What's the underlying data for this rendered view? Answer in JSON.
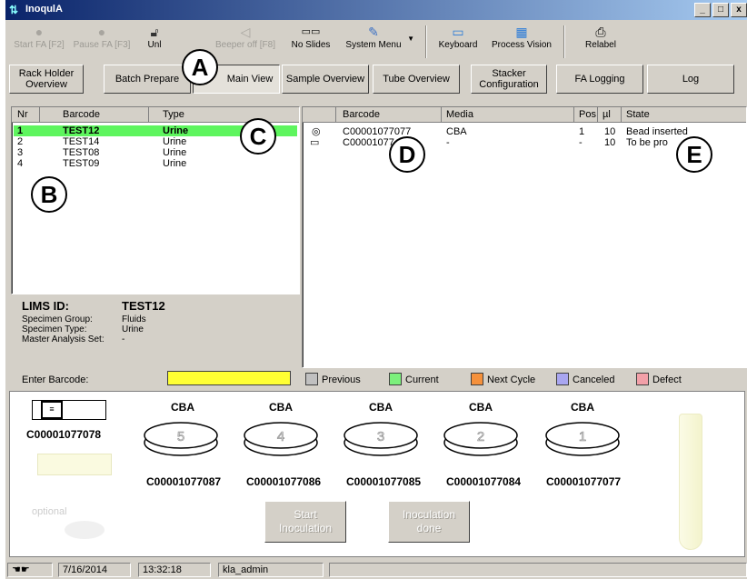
{
  "window": {
    "title": "InoqulA",
    "min": "_",
    "max": "□",
    "close": "x"
  },
  "toolbar": {
    "start": "Start FA [F2]",
    "pause": "Pause FA [F3]",
    "unlock": "Unl",
    "beeper": "Beeper off [F8]",
    "no_slides": "No Slides",
    "system_menu": "System Menu",
    "keyboard": "Keyboard",
    "process_vision": "Process Vision",
    "relabel": "Relabel"
  },
  "tabs": {
    "rack_1": "Rack Holder",
    "rack_2": "Overview",
    "batch": "Batch Prepare",
    "main": "Main View",
    "sample": "Sample Overview",
    "tube": "Tube Overview",
    "stacker_1": "Stacker",
    "stacker_2": "Configuration",
    "fa_logging": "FA Logging",
    "log": "Log"
  },
  "left_table": {
    "headers": {
      "nr": "Nr",
      "barcode": "Barcode",
      "type": "Type"
    },
    "rows": [
      {
        "nr": "1",
        "barcode": "TEST12",
        "type": "Urine"
      },
      {
        "nr": "2",
        "barcode": "TEST14",
        "type": "Urine"
      },
      {
        "nr": "3",
        "barcode": "TEST08",
        "type": "Urine"
      },
      {
        "nr": "4",
        "barcode": "TEST09",
        "type": "Urine"
      }
    ]
  },
  "right_table": {
    "headers": {
      "barcode": "Barcode",
      "media": "Media",
      "pos": "Pos",
      "ul": "µl",
      "state": "State"
    },
    "rows": [
      {
        "barcode": "C00001077077",
        "media": "CBA",
        "pos": "1",
        "ul": "10",
        "state": "Bead inserted"
      },
      {
        "barcode": "C00001077",
        "media": "-",
        "pos": "-",
        "ul": "10",
        "state": "To be pro"
      }
    ]
  },
  "specimen": {
    "lims_label": "LIMS ID:",
    "lims_value": "TEST12",
    "group_label": "Specimen Group:",
    "group_value": "Fluids",
    "type_label": "Specimen Type:",
    "type_value": "Urine",
    "master_label": "Master Analysis Set:",
    "master_value": "-"
  },
  "enter_barcode": "Enter Barcode:",
  "legend": {
    "previous": "Previous",
    "current": "Current",
    "next_cycle": "Next Cycle",
    "canceled": "Canceled",
    "defect": "Defect",
    "colors": {
      "previous": "#c0c0c0",
      "current": "#7cf07c",
      "next_cycle": "#f5913c",
      "canceled": "#a9a6f0",
      "defect": "#f2a0a8",
      "barcode_field": "#ffff33"
    }
  },
  "slides": {
    "tube_code": "C00001077078",
    "dishes": [
      {
        "media": "CBA",
        "num": "5",
        "code": "C00001077087"
      },
      {
        "media": "CBA",
        "num": "4",
        "code": "C00001077086"
      },
      {
        "media": "CBA",
        "num": "3",
        "code": "C00001077085"
      },
      {
        "media": "CBA",
        "num": "2",
        "code": "C00001077084"
      },
      {
        "media": "CBA",
        "num": "1",
        "code": "C00001077077"
      }
    ],
    "start_1": "Start",
    "start_2": "Inoculation",
    "done_1": "Inoculation",
    "done_2": "done",
    "faded_label": "optional"
  },
  "status": {
    "date": "7/16/2014",
    "time": "13:32:18",
    "user": "kla_admin"
  },
  "callouts": {
    "a": "A",
    "b": "B",
    "c": "C",
    "d": "D",
    "e": "E"
  }
}
